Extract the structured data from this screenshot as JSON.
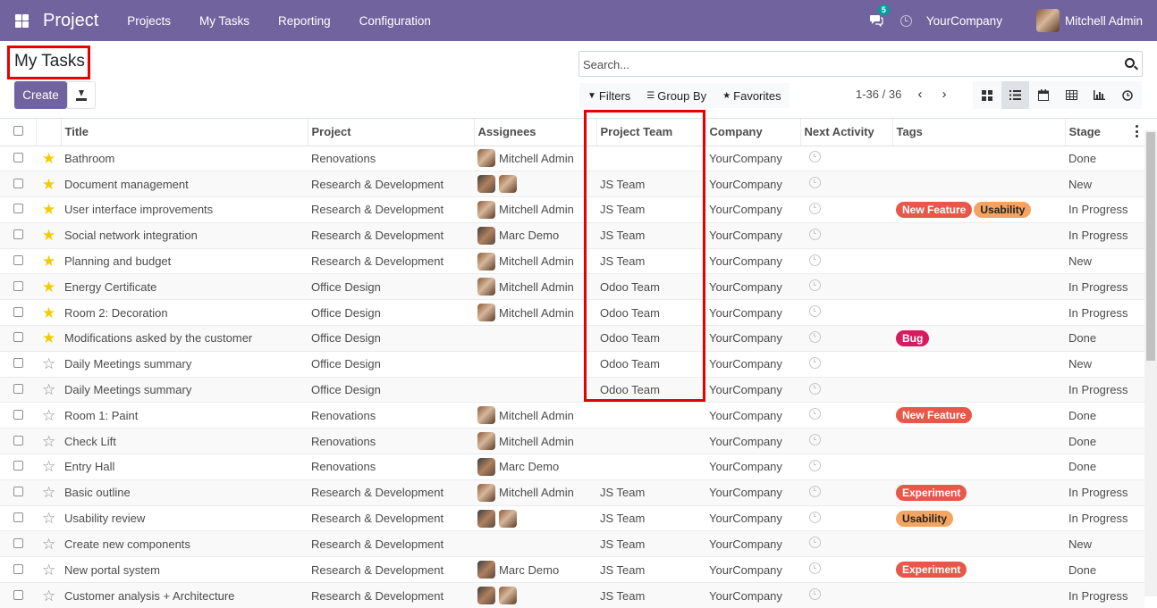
{
  "navbar": {
    "brand": "Project",
    "menu": [
      "Projects",
      "My Tasks",
      "Reporting",
      "Configuration"
    ],
    "messages_count": "5",
    "company": "YourCompany",
    "user": "Mitchell Admin"
  },
  "page": {
    "title": "My Tasks",
    "create_label": "Create"
  },
  "search": {
    "placeholder": "Search...",
    "filters_label": "Filters",
    "groupby_label": "Group By",
    "favorites_label": "Favorites"
  },
  "pager": {
    "range": "1-36 / 36"
  },
  "views": [
    "kanban-view-icon",
    "list-view-icon",
    "calendar-view-icon",
    "pivot-view-icon",
    "graph-view-icon",
    "activity-view-icon"
  ],
  "columns": [
    "Title",
    "Project",
    "Assignees",
    "Project Team",
    "Company",
    "Next Activity",
    "Tags",
    "Stage"
  ],
  "tag_colors": {
    "New Feature": "#e9574a",
    "Usability": "#f4a460",
    "Bug": "#d81b60",
    "Experiment": "#e9574a"
  },
  "rows": [
    {
      "starred": true,
      "title": "Bathroom",
      "project": "Renovations",
      "assignee": "Mitchell Admin",
      "avatars": 1,
      "team": "",
      "company": "YourCompany",
      "tags": [],
      "stage": "Done"
    },
    {
      "starred": true,
      "title": "Document management",
      "project": "Research & Development",
      "assignee": "",
      "avatars": 2,
      "team": "JS Team",
      "company": "YourCompany",
      "tags": [],
      "stage": "New"
    },
    {
      "starred": true,
      "title": "User interface improvements",
      "project": "Research & Development",
      "assignee": "Mitchell Admin",
      "avatars": 1,
      "team": "JS Team",
      "company": "YourCompany",
      "tags": [
        "New Feature",
        "Usability"
      ],
      "stage": "In Progress"
    },
    {
      "starred": true,
      "title": "Social network integration",
      "project": "Research & Development",
      "assignee": "Marc Demo",
      "avatars": 1,
      "team": "JS Team",
      "company": "YourCompany",
      "tags": [],
      "stage": "In Progress"
    },
    {
      "starred": true,
      "title": "Planning and budget",
      "project": "Research & Development",
      "assignee": "Mitchell Admin",
      "avatars": 1,
      "team": "JS Team",
      "company": "YourCompany",
      "tags": [],
      "stage": "New"
    },
    {
      "starred": true,
      "title": "Energy Certificate",
      "project": "Office Design",
      "assignee": "Mitchell Admin",
      "avatars": 1,
      "team": "Odoo Team",
      "company": "YourCompany",
      "tags": [],
      "stage": "In Progress"
    },
    {
      "starred": true,
      "title": "Room 2: Decoration",
      "project": "Office Design",
      "assignee": "Mitchell Admin",
      "avatars": 1,
      "team": "Odoo Team",
      "company": "YourCompany",
      "tags": [],
      "stage": "In Progress"
    },
    {
      "starred": true,
      "title": "Modifications asked by the customer",
      "project": "Office Design",
      "assignee": "",
      "avatars": 0,
      "team": "Odoo Team",
      "company": "YourCompany",
      "tags": [
        "Bug"
      ],
      "stage": "Done"
    },
    {
      "starred": false,
      "title": "Daily Meetings summary",
      "project": "Office Design",
      "assignee": "",
      "avatars": 0,
      "team": "Odoo Team",
      "company": "YourCompany",
      "tags": [],
      "stage": "New"
    },
    {
      "starred": false,
      "title": "Daily Meetings summary",
      "project": "Office Design",
      "assignee": "",
      "avatars": 0,
      "team": "Odoo Team",
      "company": "YourCompany",
      "tags": [],
      "stage": "In Progress"
    },
    {
      "starred": false,
      "title": "Room 1: Paint",
      "project": "Renovations",
      "assignee": "Mitchell Admin",
      "avatars": 1,
      "team": "",
      "company": "YourCompany",
      "tags": [
        "New Feature"
      ],
      "stage": "Done"
    },
    {
      "starred": false,
      "title": "Check Lift",
      "project": "Renovations",
      "assignee": "Mitchell Admin",
      "avatars": 1,
      "team": "",
      "company": "YourCompany",
      "tags": [],
      "stage": "Done"
    },
    {
      "starred": false,
      "title": "Entry Hall",
      "project": "Renovations",
      "assignee": "Marc Demo",
      "avatars": 1,
      "team": "",
      "company": "YourCompany",
      "tags": [],
      "stage": "Done"
    },
    {
      "starred": false,
      "title": "Basic outline",
      "project": "Research & Development",
      "assignee": "Mitchell Admin",
      "avatars": 1,
      "team": "JS Team",
      "company": "YourCompany",
      "tags": [
        "Experiment"
      ],
      "stage": "In Progress"
    },
    {
      "starred": false,
      "title": "Usability review",
      "project": "Research & Development",
      "assignee": "",
      "avatars": 2,
      "team": "JS Team",
      "company": "YourCompany",
      "tags": [
        "Usability"
      ],
      "stage": "In Progress"
    },
    {
      "starred": false,
      "title": "Create new components",
      "project": "Research & Development",
      "assignee": "",
      "avatars": 0,
      "team": "JS Team",
      "company": "YourCompany",
      "tags": [],
      "stage": "New"
    },
    {
      "starred": false,
      "title": "New portal system",
      "project": "Research & Development",
      "assignee": "Marc Demo",
      "avatars": 1,
      "team": "JS Team",
      "company": "YourCompany",
      "tags": [
        "Experiment"
      ],
      "stage": "Done"
    },
    {
      "starred": false,
      "title": "Customer analysis + Architecture",
      "project": "Research & Development",
      "assignee": "",
      "avatars": 2,
      "team": "JS Team",
      "company": "YourCompany",
      "tags": [],
      "stage": "In Progress"
    }
  ]
}
